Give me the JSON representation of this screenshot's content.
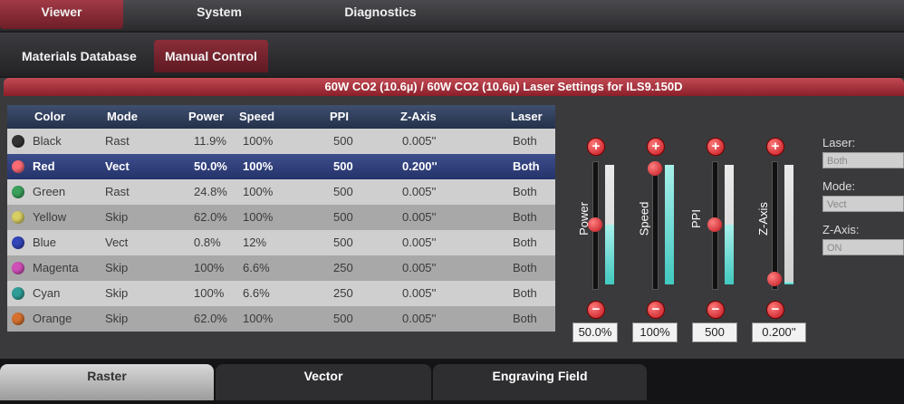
{
  "top_tabs": [
    {
      "label": "Viewer",
      "active": true
    },
    {
      "label": "System",
      "active": false
    },
    {
      "label": "Diagnostics",
      "active": false
    }
  ],
  "sub_tabs": [
    {
      "label": "Materials Database",
      "active": false
    },
    {
      "label": "Manual Control",
      "active": true
    }
  ],
  "panel_title": "60W CO2 (10.6µ)  / 60W CO2 (10.6µ) Laser Settings for ILS9.150D",
  "table": {
    "headers": [
      "Color",
      "Mode",
      "Power",
      "Speed",
      "PPI",
      "Z-Axis",
      "Laser"
    ],
    "rows": [
      {
        "color": "Black",
        "swatch": "#333333",
        "mode": "Rast",
        "power": "11.9%",
        "speed": "100%",
        "ppi": "500",
        "z": "0.005''",
        "laser": "Both"
      },
      {
        "color": "Red",
        "swatch": "#ff6b75",
        "mode": "Vect",
        "power": "50.0%",
        "speed": "100%",
        "ppi": "500",
        "z": "0.200''",
        "laser": "Both",
        "selected": true
      },
      {
        "color": "Green",
        "swatch": "#3aa05a",
        "mode": "Rast",
        "power": "24.8%",
        "speed": "100%",
        "ppi": "500",
        "z": "0.005''",
        "laser": "Both"
      },
      {
        "color": "Yellow",
        "swatch": "#d8cf62",
        "mode": "Skip",
        "power": "62.0%",
        "speed": "100%",
        "ppi": "500",
        "z": "0.005''",
        "laser": "Both"
      },
      {
        "color": "Blue",
        "swatch": "#3344b8",
        "mode": "Vect",
        "power": "0.8%",
        "speed": "12%",
        "ppi": "500",
        "z": "0.005''",
        "laser": "Both"
      },
      {
        "color": "Magenta",
        "swatch": "#d04fb8",
        "mode": "Skip",
        "power": "100%",
        "speed": "6.6%",
        "ppi": "250",
        "z": "0.005''",
        "laser": "Both"
      },
      {
        "color": "Cyan",
        "swatch": "#2f9d96",
        "mode": "Skip",
        "power": "100%",
        "speed": "6.6%",
        "ppi": "250",
        "z": "0.005''",
        "laser": "Both"
      },
      {
        "color": "Orange",
        "swatch": "#d5702e",
        "mode": "Skip",
        "power": "62.0%",
        "speed": "100%",
        "ppi": "500",
        "z": "0.005''",
        "laser": "Both"
      }
    ]
  },
  "sliders": [
    {
      "label": "Power",
      "value": "50.0%",
      "level": 0.5
    },
    {
      "label": "Speed",
      "value": "100%",
      "level": 1.0
    },
    {
      "label": "PPI",
      "value": "500",
      "level": 0.5
    },
    {
      "label": "Z-Axis",
      "value": "0.200''",
      "level": 0.02
    }
  ],
  "side": {
    "laser_label": "Laser:",
    "laser_value": "Both",
    "mode_label": "Mode:",
    "mode_value": "Vect",
    "z_label": "Z-Axis:",
    "z_value": "ON"
  },
  "bottom_tabs": [
    "Raster",
    "Vector",
    "Engraving Field"
  ]
}
